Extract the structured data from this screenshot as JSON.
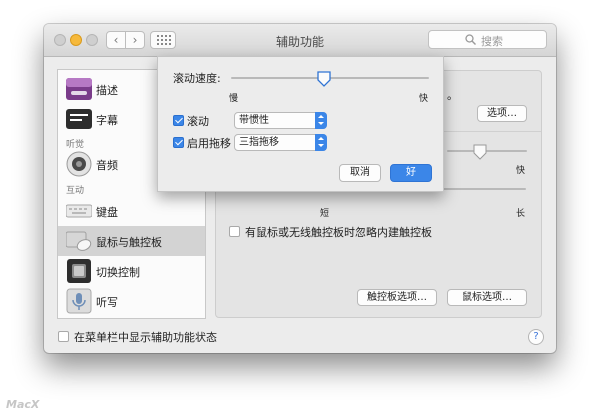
{
  "window": {
    "title": "辅助功能",
    "search_placeholder": "搜索"
  },
  "sidebar": {
    "items": [
      {
        "label": "描述",
        "icon": "display-description-icon"
      },
      {
        "label": "字幕",
        "icon": "captions-icon"
      },
      {
        "label": "音频",
        "icon": "speaker-icon"
      },
      {
        "label": "键盘",
        "icon": "keyboard-icon"
      },
      {
        "label": "鼠标与触控板",
        "icon": "mouse-trackpad-icon"
      },
      {
        "label": "切换控制",
        "icon": "switch-control-icon"
      },
      {
        "label": "听写",
        "icon": "microphone-icon"
      }
    ],
    "categories": {
      "hearing": "听觉",
      "interaction": "互动"
    },
    "selected": "鼠标与触控板"
  },
  "panel": {
    "options_button": "选项…",
    "speed_fast_label": "快",
    "delay_short_label": "短",
    "delay_long_label": "长",
    "ignore_trackpad_label": "有鼠标或无线触控板时忽略内建触控板",
    "trackpad_options_button": "触控板选项…",
    "mouse_options_button": "鼠标选项…",
    "partial_text": "。"
  },
  "footer": {
    "show_in_menu_label": "在菜单栏中显示辅助功能状态",
    "help": "?"
  },
  "sheet": {
    "scroll_speed_label": "滚动速度:",
    "slow_label": "慢",
    "fast_label": "快",
    "scroll_speed_value": 0.47,
    "scrolling_label": "滚动",
    "scrolling_checked": true,
    "scrolling_option": "带惯性",
    "drag_label": "启用拖移",
    "drag_checked": true,
    "drag_option": "三指拖移",
    "cancel_button": "取消",
    "ok_button": "好"
  },
  "watermark": "MacX",
  "colors": {
    "accent": "#3b86e8",
    "window_bg": "#ececec",
    "traffic_yellow": "#f6b93b"
  }
}
